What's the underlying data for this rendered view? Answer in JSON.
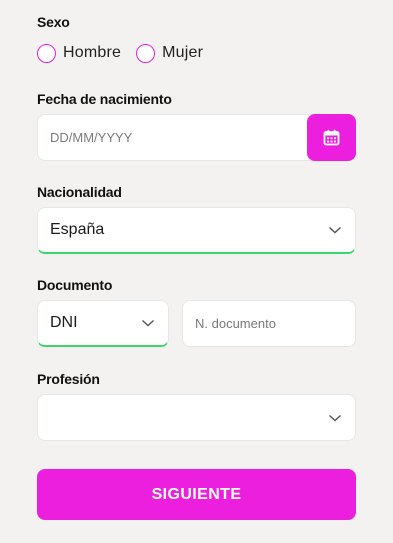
{
  "form": {
    "sexo": {
      "label": "Sexo",
      "options": [
        "Hombre",
        "Mujer"
      ]
    },
    "fecha": {
      "label": "Fecha de nacimiento",
      "placeholder": "DD/MM/YYYY",
      "icon": "calendar-icon"
    },
    "nacionalidad": {
      "label": "Nacionalidad",
      "value": "España"
    },
    "documento": {
      "label": "Documento",
      "type_value": "DNI",
      "number_placeholder": "N. documento"
    },
    "profesion": {
      "label": "Profesión",
      "value": ""
    },
    "submit_label": "SIGUIENTE"
  },
  "colors": {
    "accent": "#ec1fde",
    "valid": "#3bd66d",
    "background": "#f3f2f1"
  }
}
